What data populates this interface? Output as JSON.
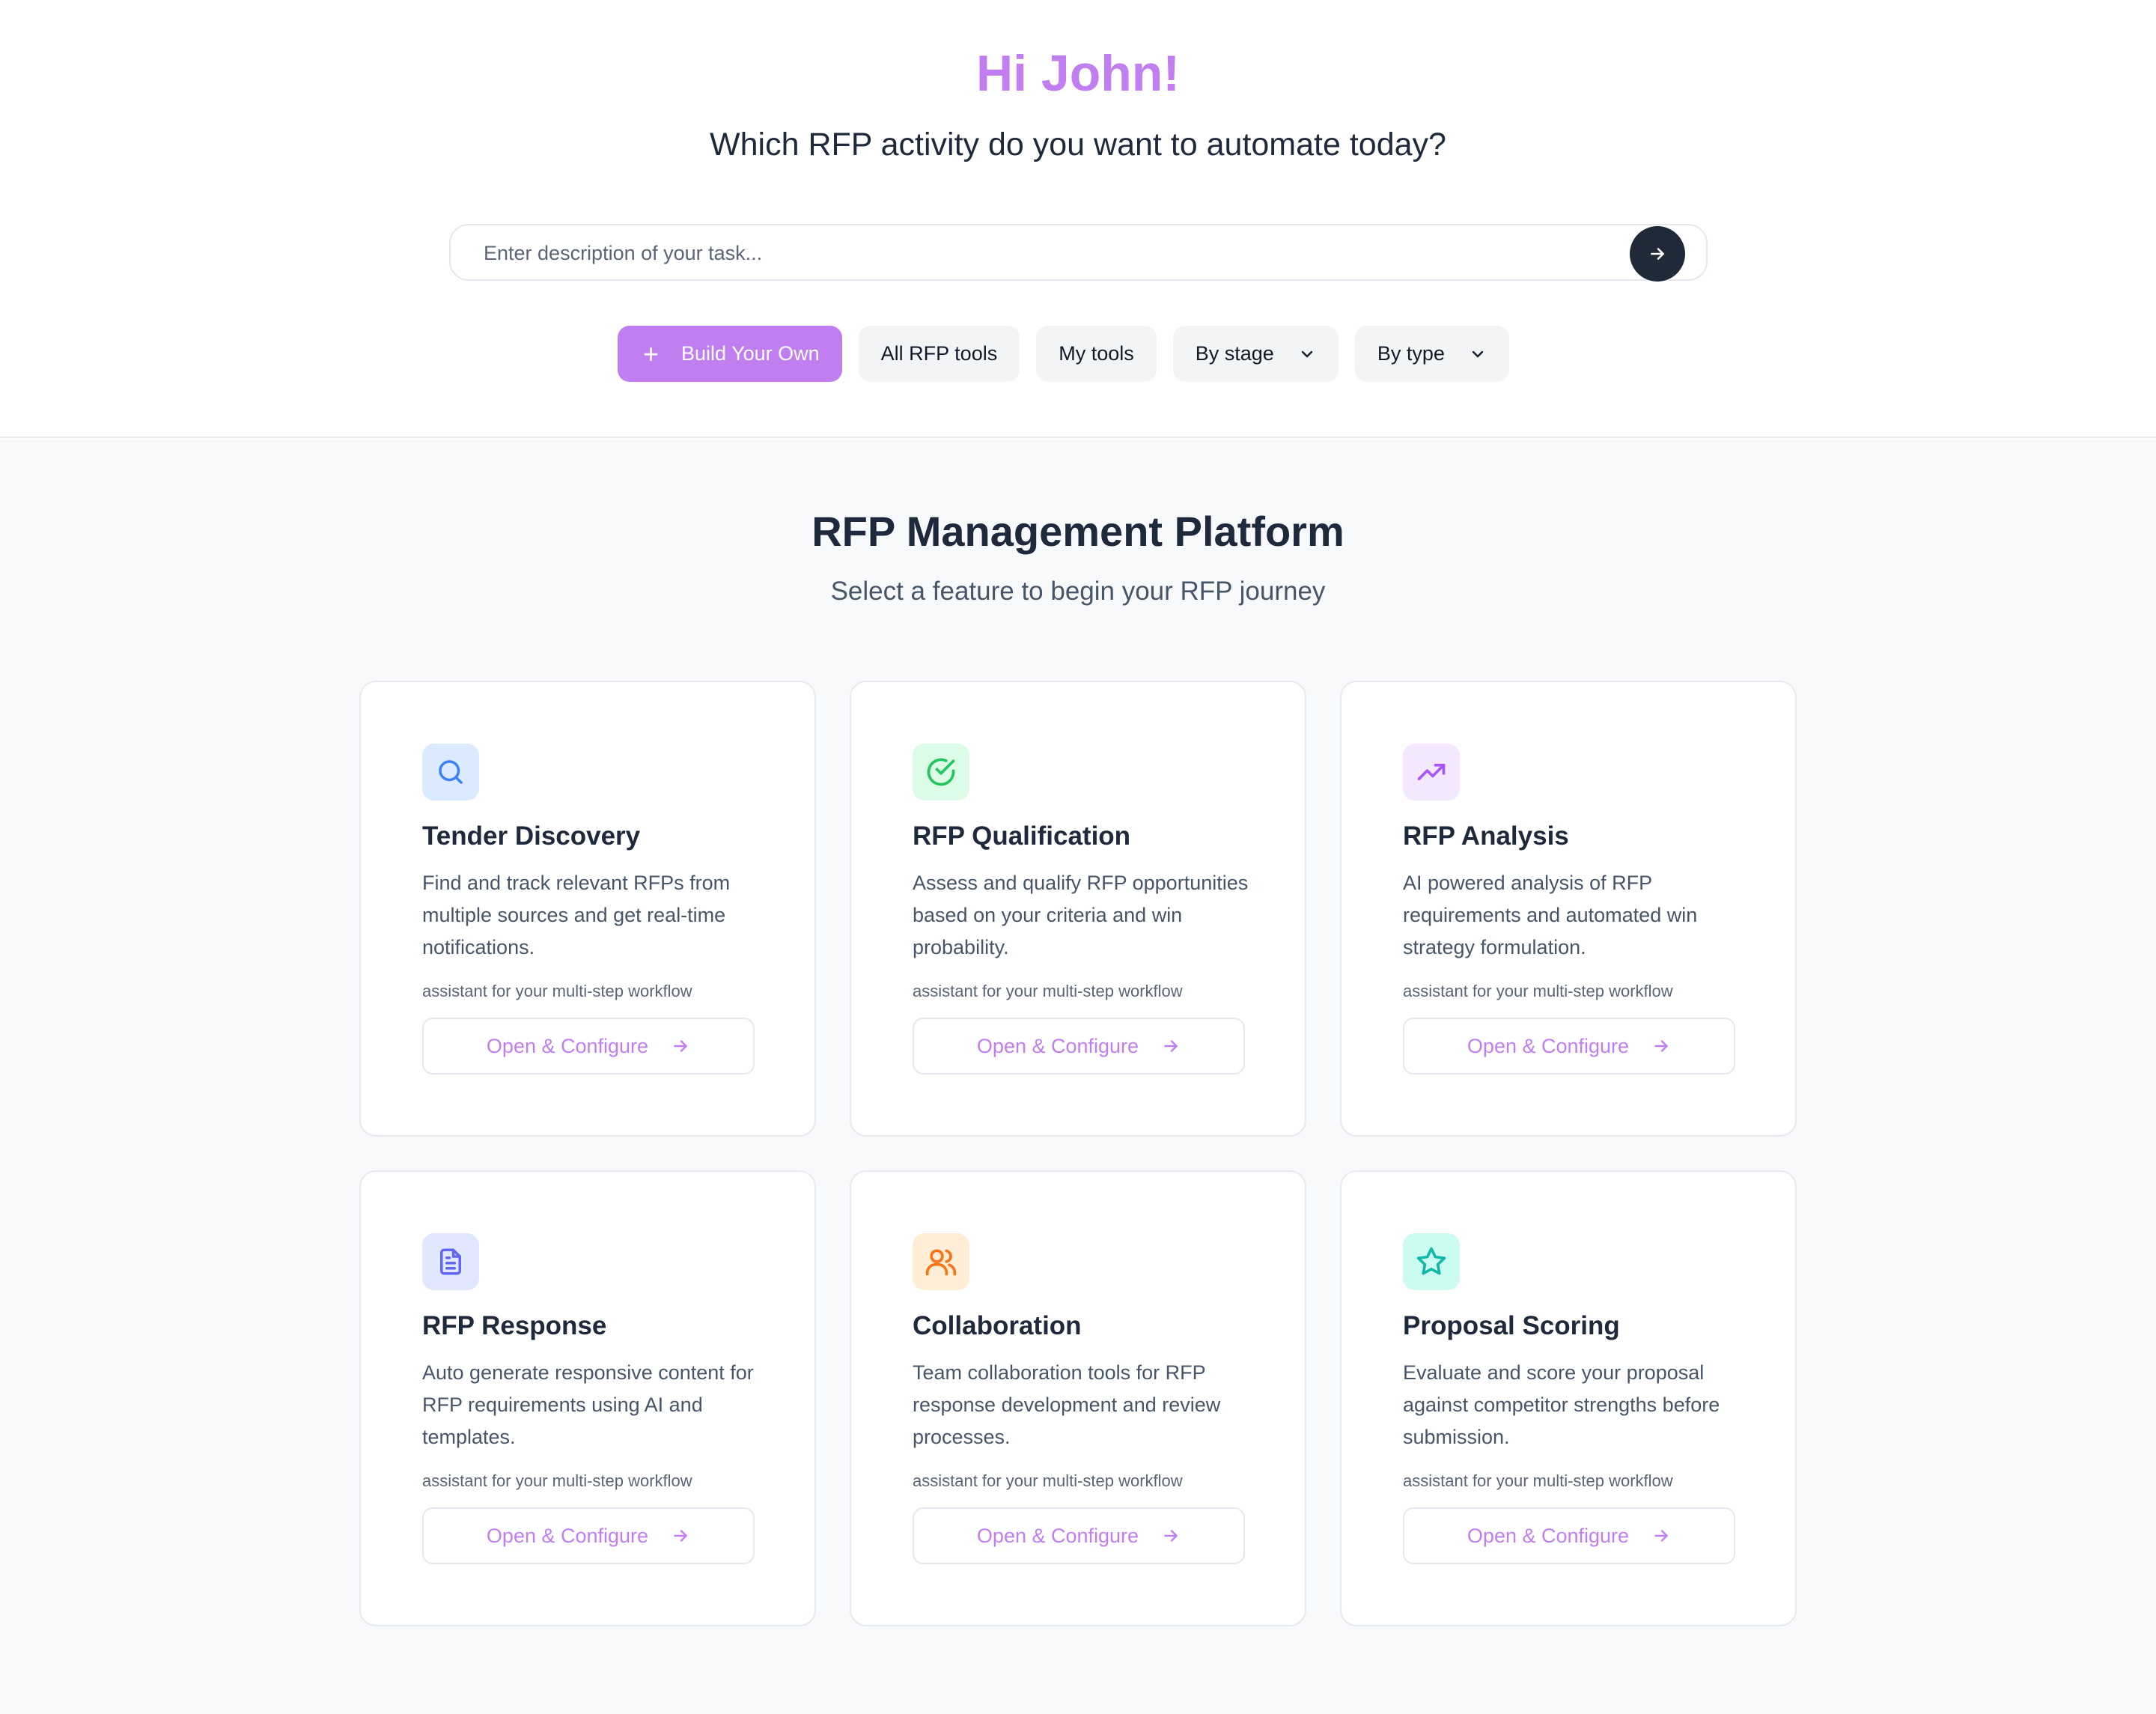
{
  "header": {
    "greeting": "Hi John!",
    "question": "Which RFP activity do you want to automate today?"
  },
  "search": {
    "placeholder": "Enter description of your task...",
    "value": ""
  },
  "filters": {
    "build": "Build Your Own",
    "all_tools": "All RFP tools",
    "my_tools": "My tools",
    "by_stage": "By stage",
    "by_type": "By type"
  },
  "section": {
    "title": "RFP Management Platform",
    "subtitle": "Select a feature to begin your RFP journey"
  },
  "cards": [
    {
      "icon": "search-icon",
      "icon_color": "#3b82f6",
      "icon_bg": "#dbeafe",
      "title": "Tender Discovery",
      "description": "Find and track relevant RFPs from multiple sources and get real-time notifications.",
      "note": "assistant for your multi-step workflow",
      "button": "Open & Configure"
    },
    {
      "icon": "check-circle-icon",
      "icon_color": "#22c55e",
      "icon_bg": "#dcfce7",
      "title": "RFP Qualification",
      "description": "Assess and qualify RFP opportunities based on your criteria and win probability.",
      "note": "assistant for your multi-step workflow",
      "button": "Open & Configure"
    },
    {
      "icon": "trending-up-icon",
      "icon_color": "#a855f7",
      "icon_bg": "#f3e8ff",
      "title": "RFP Analysis",
      "description": "AI powered analysis of RFP requirements and automated win strategy formulation.",
      "note": "assistant for your multi-step workflow",
      "button": "Open & Configure"
    },
    {
      "icon": "document-icon",
      "icon_color": "#6366f1",
      "icon_bg": "#e0e7ff",
      "title": "RFP Response",
      "description": "Auto generate responsive content for RFP requirements using AI and templates.",
      "note": "assistant for your multi-step workflow",
      "button": "Open & Configure"
    },
    {
      "icon": "users-icon",
      "icon_color": "#f97316",
      "icon_bg": "#ffedd5",
      "title": "Collaboration",
      "description": "Team collaboration tools for RFP response development and review processes.",
      "note": "assistant for your multi-step workflow",
      "button": "Open & Configure"
    },
    {
      "icon": "star-icon",
      "icon_color": "#14b8a6",
      "icon_bg": "#ccfbf1",
      "title": "Proposal Scoring",
      "description": "Evaluate and score your proposal against competitor strengths before submission.",
      "note": "assistant for your multi-step workflow",
      "button": "Open & Configure"
    }
  ],
  "colors": {
    "accent": "#c07ef0",
    "dark": "#1f2937",
    "background": "#f8f9fb"
  }
}
